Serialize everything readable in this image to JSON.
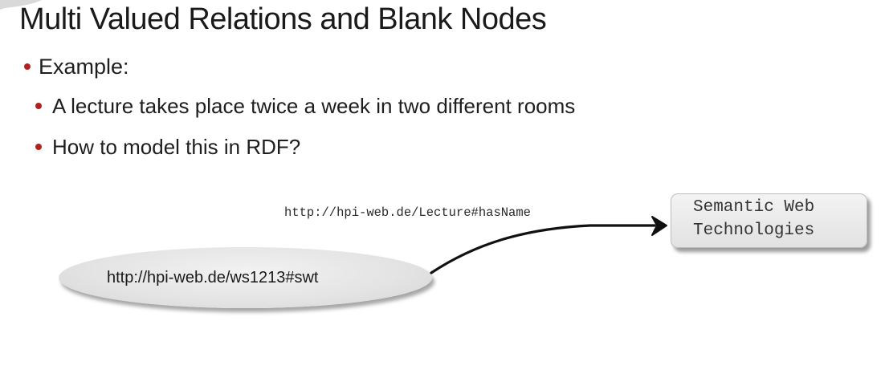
{
  "slide": {
    "title": "Multi Valued Relations and Blank Nodes",
    "bullets": {
      "level1": "Example:",
      "item1": "A lecture takes place twice a week in two different rooms",
      "item2": "How to model this in RDF?"
    }
  },
  "rdf_graph": {
    "subject": "http://hpi-web.de/ws1213#swt",
    "predicate": "http://hpi-web.de/Lecture#hasName",
    "object_line1": "Semantic Web",
    "object_line2": "Technologies"
  },
  "colors": {
    "bullet": "#b22020",
    "node_fill": "#e6e6e6"
  }
}
